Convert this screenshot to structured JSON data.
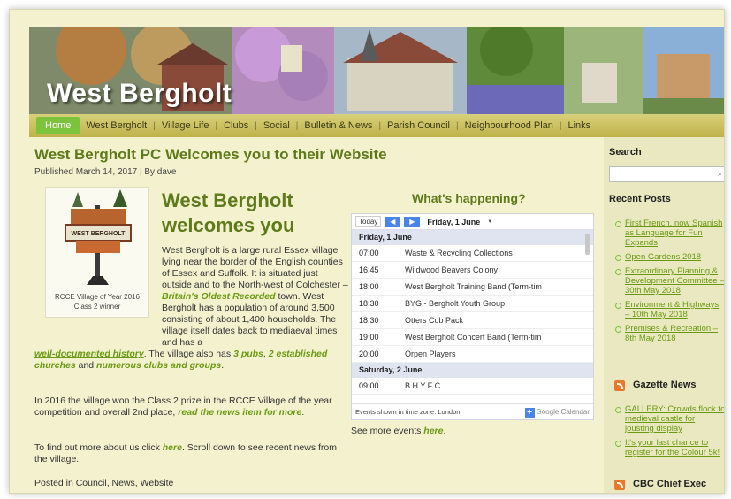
{
  "site": {
    "title": "West Bergholt",
    "nav": [
      "Home",
      "West Bergholt",
      "Village Life",
      "Clubs",
      "Social",
      "Bulletin & News",
      "Parish Council",
      "Neighbourhood Plan",
      "Links"
    ]
  },
  "post": {
    "title": "West Bergholt PC Welcomes you to their Website",
    "meta": "Published March 14, 2017 | By dave",
    "welcome": "West Bergholt welcomes you",
    "logo_sign": "WEST BERGHOLT",
    "logo_caption_1": "RCCE Village of Year 2016",
    "logo_caption_2": "Class 2 winner",
    "para1_a": "West Bergholt is a large rural Essex village lying near the border of the English counties of Essex and Suffolk.  It is situated just outside and to the North-west of Colchester – ",
    "para1_link": "Britain's Oldest Recorded",
    "para1_b": " town. West Bergholt has a population of around 3,500 consisting of about 1,400 households.  The village itself dates back to mediaeval times and has a ",
    "para1_link2": "well-documented history",
    "para1_c": ".  The village also has ",
    "para1_link3": "3 pubs",
    "para1_sep": ", ",
    "para1_link4": "2 established churches",
    "para1_and": " and ",
    "para1_link5": "numerous clubs and groups",
    "para1_end": ".",
    "para2_a": "In 2016 the village won the Class 2 prize in the RCCE Village of the year competition and overall 2nd place, ",
    "para2_link": "read the news item for more",
    "para2_end": ".",
    "para3_a": "To find out more about us click ",
    "para3_link": "here",
    "para3_b": ".  Scroll down to see recent news from the village.",
    "posted_in": "Posted in Council, News, Website"
  },
  "calendar": {
    "title": "What's happening?",
    "today_label": "Today",
    "prev_icon": "◀",
    "next_icon": "▶",
    "current_date": "Friday, 1 June",
    "dropdown_icon": "▼",
    "days": [
      {
        "heading": "Friday, 1 June",
        "events": [
          {
            "time": "07:00",
            "title": "Waste & Recycling Collections"
          },
          {
            "time": "16:45",
            "title": "Wildwood Beavers Colony"
          },
          {
            "time": "18:00",
            "title": "West Bergholt Training Band (Term-tim"
          },
          {
            "time": "18:30",
            "title": "BYG - Bergholt Youth Group"
          },
          {
            "time": "18:30",
            "title": "Otters Cub Pack"
          },
          {
            "time": "19:00",
            "title": "West Bergholt Concert Band (Term-tim"
          },
          {
            "time": "20:00",
            "title": "Orpen Players"
          }
        ]
      },
      {
        "heading": "Saturday, 2 June",
        "events": [
          {
            "time": "09:00",
            "title": "B H Y F C"
          }
        ]
      }
    ],
    "timezone": "Events shown in time zone: London",
    "gcal_label": "Google Calendar",
    "see_more_a": "See more events ",
    "see_more_link": "here",
    "see_more_end": "."
  },
  "sidebar": {
    "search_heading": "Search",
    "recent_heading": "Recent Posts",
    "recent_posts": [
      "First French, now Spanish as Language for Fun Expands",
      "Open Gardens 2018",
      "Extraordinary Planning & Development Committee – 30th May 2018",
      "Environment & Highways – 10th May 2018",
      "Premises & Recreation – 8th May 2018"
    ],
    "gazette_heading": "Gazette News",
    "gazette_posts": [
      "GALLERY: Crowds flock to medieval castle for jousting display",
      "It's your last chance to register for the Colour 5k!"
    ],
    "cbc_heading": "CBC Chief Exec"
  },
  "colors": {
    "accent_green": "#5e7a1a",
    "link_green": "#6a9a12",
    "nav_active": "#7ac33b",
    "page_bg": "#f4f1cf",
    "rss_orange": "#e8792b"
  }
}
